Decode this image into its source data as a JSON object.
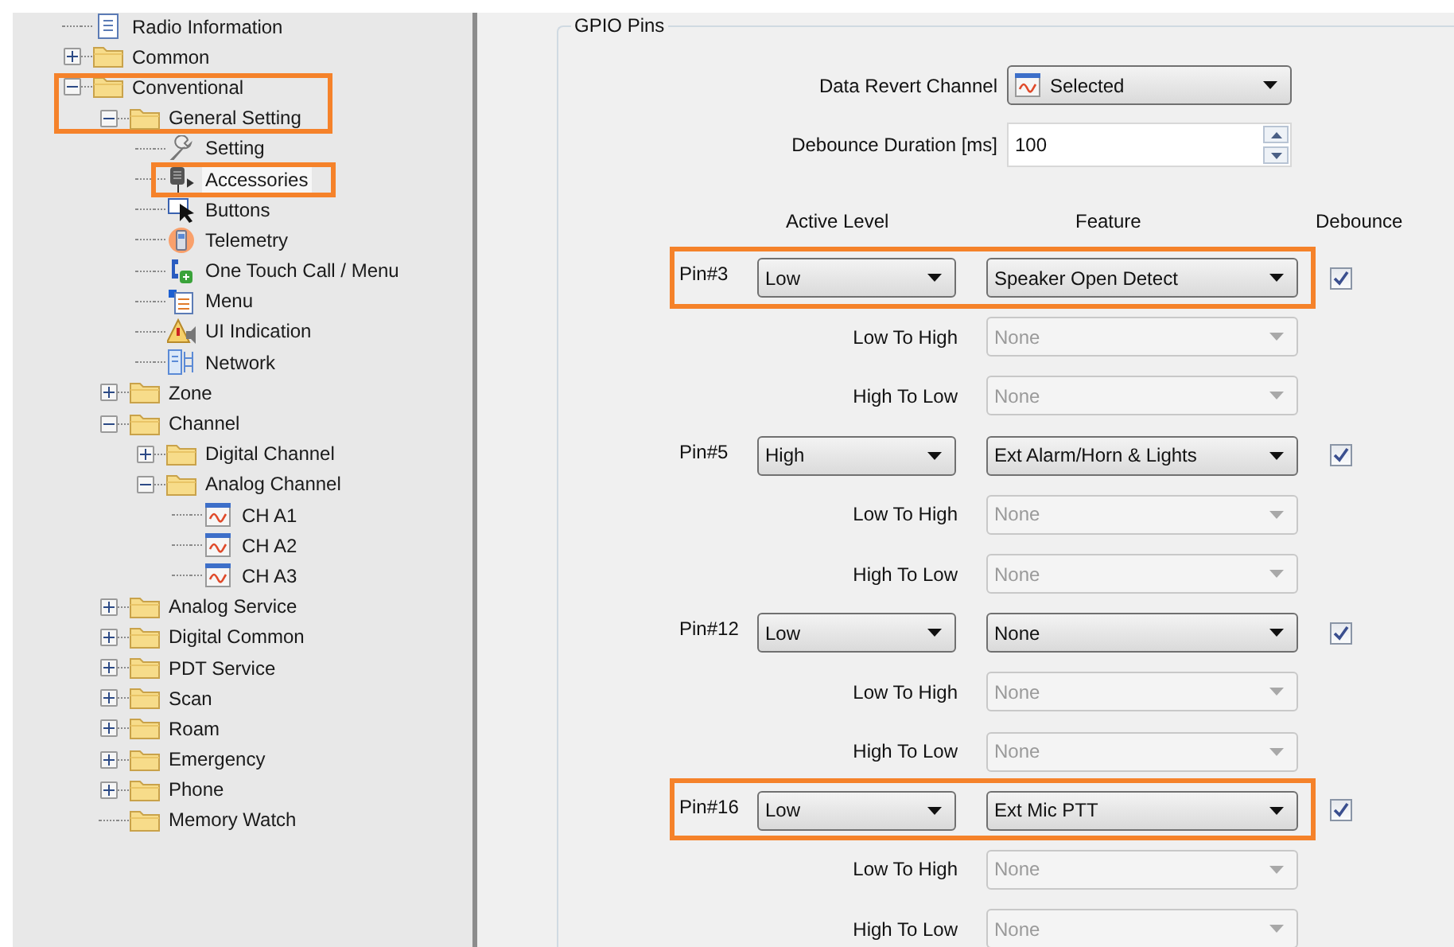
{
  "tree": [
    {
      "label": "Radio Information",
      "kind": "document",
      "selected": false
    },
    {
      "label": "Common",
      "kind": "folder",
      "expanded": false,
      "selected": false
    },
    {
      "label": "Conventional",
      "kind": "folder",
      "expanded": true,
      "selected": false,
      "outlined": true,
      "children": [
        {
          "label": "General Setting",
          "kind": "folder",
          "expanded": true,
          "selected": false,
          "outlined": true,
          "children": [
            {
              "label": "Setting",
              "kind": "wrench",
              "selected": false
            },
            {
              "label": "Accessories",
              "kind": "microphone",
              "selected": true,
              "outlined": true
            },
            {
              "label": "Buttons",
              "kind": "cursor",
              "selected": false
            },
            {
              "label": "Telemetry",
              "kind": "telemetry",
              "selected": false
            },
            {
              "label": "One Touch Call / Menu",
              "kind": "phone",
              "selected": false
            },
            {
              "label": "Menu",
              "kind": "menu",
              "selected": false
            },
            {
              "label": "UI Indication",
              "kind": "warning",
              "selected": false
            },
            {
              "label": "Network",
              "kind": "network",
              "selected": false
            }
          ]
        },
        {
          "label": "Zone",
          "kind": "folder",
          "expanded": false,
          "selected": false
        },
        {
          "label": "Channel",
          "kind": "folder",
          "expanded": true,
          "selected": false,
          "children": [
            {
              "label": "Digital Channel",
              "kind": "folder",
              "expanded": false,
              "selected": false
            },
            {
              "label": "Analog Channel",
              "kind": "folder",
              "expanded": true,
              "selected": false,
              "children": [
                {
                  "label": "CH A1",
                  "kind": "channel",
                  "selected": false
                },
                {
                  "label": "CH A2",
                  "kind": "channel",
                  "selected": false
                },
                {
                  "label": "CH A3",
                  "kind": "channel",
                  "selected": false
                }
              ]
            }
          ]
        },
        {
          "label": "Analog Service",
          "kind": "folder",
          "expanded": false,
          "selected": false
        },
        {
          "label": "Digital Common",
          "kind": "folder",
          "expanded": false,
          "selected": false
        },
        {
          "label": "PDT Service",
          "kind": "folder",
          "expanded": false,
          "selected": false
        },
        {
          "label": "Scan",
          "kind": "folder",
          "expanded": false,
          "selected": false
        },
        {
          "label": "Roam",
          "kind": "folder",
          "expanded": false,
          "selected": false
        },
        {
          "label": "Emergency",
          "kind": "folder",
          "expanded": false,
          "selected": false
        },
        {
          "label": "Phone",
          "kind": "folder",
          "expanded": false,
          "selected": false
        },
        {
          "label": "Memory Watch",
          "kind": "folder",
          "selected": false
        }
      ]
    }
  ],
  "group": {
    "title": "GPIO Pins",
    "fields": [
      {
        "label": "Data Revert Channel",
        "kind": "combo",
        "value": "Selected"
      },
      {
        "label": "Debounce Duration [ms]",
        "kind": "spin",
        "value": "100"
      }
    ],
    "headers": [
      "Active Level",
      "Feature",
      "Debounce"
    ],
    "pins": [
      {
        "label": "Pin#3",
        "active_level": "Low",
        "feature": "Speaker Open Detect",
        "debounce_checked": true,
        "outlined": true,
        "transitions": [
          {
            "label": "Low To High",
            "value": "None",
            "disabled": true
          },
          {
            "label": "High To Low",
            "value": "None",
            "disabled": true
          }
        ]
      },
      {
        "label": "Pin#5",
        "active_level": "High",
        "feature": "Ext Alarm/Horn & Lights",
        "debounce_checked": true,
        "outlined": false,
        "transitions": [
          {
            "label": "Low To High",
            "value": "None",
            "disabled": true
          },
          {
            "label": "High To Low",
            "value": "None",
            "disabled": true
          }
        ]
      },
      {
        "label": "Pin#12",
        "active_level": "Low",
        "feature": "None",
        "debounce_checked": true,
        "outlined": false,
        "transitions": [
          {
            "label": "Low To High",
            "value": "None",
            "disabled": true
          },
          {
            "label": "High To Low",
            "value": "None",
            "disabled": true
          }
        ]
      },
      {
        "label": "Pin#16",
        "active_level": "Low",
        "feature": "Ext Mic PTT",
        "debounce_checked": true,
        "outlined": true,
        "transitions": [
          {
            "label": "Low To High",
            "value": "None",
            "disabled": true
          },
          {
            "label": "High To Low",
            "value": "None",
            "disabled": true
          }
        ]
      }
    ]
  }
}
